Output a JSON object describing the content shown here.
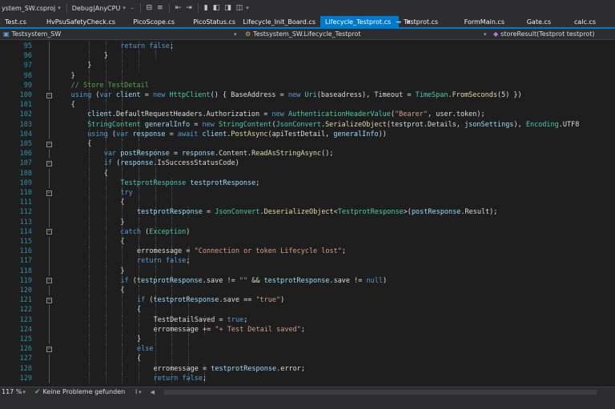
{
  "toolbar": {
    "project_label": "ystem_SW.csproj",
    "config_label": "Debug|AnyCPU"
  },
  "tabs": [
    {
      "label": "Test.cs",
      "active": false
    },
    {
      "label": "HvPsuSafetyCheck.cs",
      "active": false
    },
    {
      "label": "PicoScope.cs",
      "active": false
    },
    {
      "label": "PicoStatus.cs",
      "active": false
    },
    {
      "label": "Lifecycle_Init_Board.cs",
      "active": false
    },
    {
      "label": "Lifecycle_Testprot.cs",
      "active": true
    },
    {
      "label": "Testprot.cs",
      "active": false
    },
    {
      "label": "FormMain.cs",
      "active": false
    },
    {
      "label": "Gate.cs",
      "active": false
    },
    {
      "label": "calc.cs",
      "active": false
    }
  ],
  "navbar": {
    "project": "Testsystem_SW",
    "class": "Testsystem_SW.Lifecycle_Testprot",
    "member": "storeResult(Testprot testprot)"
  },
  "editor": {
    "lines": [
      {
        "num": "95",
        "indent": 8,
        "tokens": [
          [
            "kw",
            "return "
          ],
          [
            "kw",
            "false"
          ],
          [
            "pr",
            ";"
          ]
        ]
      },
      {
        "num": "96",
        "indent": 7,
        "tokens": [
          [
            "pr",
            "}"
          ]
        ]
      },
      {
        "num": "97",
        "indent": 6,
        "tokens": [
          [
            "pr",
            "}"
          ]
        ]
      },
      {
        "num": "98",
        "indent": 5,
        "tokens": [
          [
            "pr",
            "}"
          ]
        ]
      },
      {
        "num": "99",
        "indent": 5,
        "tokens": [
          [
            "cm",
            "// Store TestDetail"
          ]
        ]
      },
      {
        "num": "100",
        "indent": 5,
        "tokens": [
          [
            "kw",
            "using "
          ],
          [
            "pr",
            "("
          ],
          [
            "kw",
            "var "
          ],
          [
            "vr",
            "client"
          ],
          [
            "pr",
            " = "
          ],
          [
            "kw",
            "new "
          ],
          [
            "ty",
            "HttpClient"
          ],
          [
            "pr",
            "() { BaseAddress = "
          ],
          [
            "kw",
            "new "
          ],
          [
            "ty",
            "Uri"
          ],
          [
            "pr",
            "(baseadress), Timeout = "
          ],
          [
            "ty",
            "TimeSpan"
          ],
          [
            "pr",
            "."
          ],
          [
            "mt",
            "FromSeconds"
          ],
          [
            "pr",
            "(5) })"
          ]
        ]
      },
      {
        "num": "101",
        "indent": 5,
        "tokens": [
          [
            "pr",
            "{"
          ]
        ]
      },
      {
        "num": "102",
        "indent": 6,
        "tokens": [
          [
            "vr",
            "client"
          ],
          [
            "pr",
            ".DefaultRequestHeaders.Authorization = "
          ],
          [
            "kw",
            "new "
          ],
          [
            "ty",
            "AuthenticationHeaderValue"
          ],
          [
            "pr",
            "("
          ],
          [
            "st",
            "\"Bearer\""
          ],
          [
            "pr",
            ", user.token);"
          ]
        ]
      },
      {
        "num": "103",
        "indent": 6,
        "tokens": [
          [
            "ty",
            "StringContent "
          ],
          [
            "vr",
            "generalInfo"
          ],
          [
            "pr",
            " = "
          ],
          [
            "kw",
            "new "
          ],
          [
            "ty",
            "StringContent"
          ],
          [
            "pr",
            "("
          ],
          [
            "ty",
            "JsonConvert"
          ],
          [
            "pr",
            "."
          ],
          [
            "mt",
            "SerializeObject"
          ],
          [
            "pr",
            "(testprot.Details, "
          ],
          [
            "vr",
            "jsonSettings"
          ],
          [
            "pr",
            "), "
          ],
          [
            "ty",
            "Encoding"
          ],
          [
            "pr",
            ".UTF8"
          ]
        ]
      },
      {
        "num": "104",
        "indent": 6,
        "tokens": [
          [
            "kw",
            "using "
          ],
          [
            "pr",
            "("
          ],
          [
            "kw",
            "var "
          ],
          [
            "vr",
            "response"
          ],
          [
            "pr",
            " = "
          ],
          [
            "kw",
            "await "
          ],
          [
            "vr",
            "client"
          ],
          [
            "pr",
            "."
          ],
          [
            "mt",
            "PostAsync"
          ],
          [
            "pr",
            "(apiTestDetail, "
          ],
          [
            "vr",
            "generalInfo"
          ],
          [
            "pr",
            "))"
          ]
        ]
      },
      {
        "num": "105",
        "indent": 6,
        "tokens": [
          [
            "pr",
            "{"
          ]
        ]
      },
      {
        "num": "106",
        "indent": 7,
        "tokens": [
          [
            "kw",
            "var "
          ],
          [
            "vr",
            "postResponse"
          ],
          [
            "pr",
            " = "
          ],
          [
            "vr",
            "response"
          ],
          [
            "pr",
            ".Content."
          ],
          [
            "mt",
            "ReadAsStringAsync"
          ],
          [
            "pr",
            "();"
          ]
        ]
      },
      {
        "num": "107",
        "indent": 7,
        "tokens": [
          [
            "kw",
            "if "
          ],
          [
            "pr",
            "("
          ],
          [
            "vr",
            "response"
          ],
          [
            "pr",
            ".IsSuccessStatusCode)"
          ]
        ]
      },
      {
        "num": "108",
        "indent": 7,
        "tokens": [
          [
            "pr",
            "{"
          ]
        ]
      },
      {
        "num": "109",
        "indent": 8,
        "tokens": [
          [
            "ty",
            "TestprotResponse "
          ],
          [
            "vr",
            "testprotResponse"
          ],
          [
            "pr",
            ";"
          ]
        ]
      },
      {
        "num": "110",
        "indent": 8,
        "tokens": [
          [
            "kw",
            "try"
          ]
        ]
      },
      {
        "num": "111",
        "indent": 8,
        "tokens": [
          [
            "pr",
            "{"
          ]
        ]
      },
      {
        "num": "112",
        "indent": 9,
        "tokens": [
          [
            "vr",
            "testprotResponse"
          ],
          [
            "pr",
            " = "
          ],
          [
            "ty",
            "JsonConvert"
          ],
          [
            "pr",
            "."
          ],
          [
            "mt",
            "DeserializeObject"
          ],
          [
            "pr",
            "<"
          ],
          [
            "ty",
            "TestprotResponse"
          ],
          [
            "pr",
            ">("
          ],
          [
            "vr",
            "postResponse"
          ],
          [
            "pr",
            ".Result);"
          ]
        ]
      },
      {
        "num": "113",
        "indent": 8,
        "tokens": [
          [
            "pr",
            "}"
          ]
        ]
      },
      {
        "num": "114",
        "indent": 8,
        "tokens": [
          [
            "kw",
            "catch "
          ],
          [
            "pr",
            "("
          ],
          [
            "ty",
            "Exception"
          ],
          [
            "pr",
            ")"
          ]
        ]
      },
      {
        "num": "115",
        "indent": 8,
        "tokens": [
          [
            "pr",
            "{"
          ]
        ]
      },
      {
        "num": "116",
        "indent": 9,
        "tokens": [
          [
            "pr",
            "erromessage = "
          ],
          [
            "st",
            "\"Connection or token Lifecycle lost\""
          ],
          [
            "pr",
            ";"
          ]
        ]
      },
      {
        "num": "117",
        "indent": 9,
        "tokens": [
          [
            "kw",
            "return "
          ],
          [
            "kw",
            "false"
          ],
          [
            "pr",
            ";"
          ]
        ]
      },
      {
        "num": "118",
        "indent": 8,
        "tokens": [
          [
            "pr",
            "}"
          ]
        ]
      },
      {
        "num": "119",
        "indent": 8,
        "tokens": [
          [
            "kw",
            "if "
          ],
          [
            "pr",
            "("
          ],
          [
            "vr",
            "testprotResponse"
          ],
          [
            "pr",
            ".save != "
          ],
          [
            "st",
            "\"\""
          ],
          [
            "pr",
            " && "
          ],
          [
            "vr",
            "testprotResponse"
          ],
          [
            "pr",
            ".save != "
          ],
          [
            "kw",
            "null"
          ],
          [
            "pr",
            ")"
          ]
        ]
      },
      {
        "num": "120",
        "indent": 8,
        "tokens": [
          [
            "pr",
            "{"
          ]
        ]
      },
      {
        "num": "121",
        "indent": 9,
        "tokens": [
          [
            "kw",
            "if "
          ],
          [
            "pr",
            "("
          ],
          [
            "vr",
            "testprotResponse"
          ],
          [
            "pr",
            ".save == "
          ],
          [
            "st",
            "\"true\""
          ],
          [
            "pr",
            ")"
          ]
        ]
      },
      {
        "num": "122",
        "indent": 9,
        "tokens": [
          [
            "pr",
            "{"
          ]
        ]
      },
      {
        "num": "123",
        "indent": 10,
        "tokens": [
          [
            "pr",
            "TestDetailSaved = "
          ],
          [
            "kw",
            "true"
          ],
          [
            "pr",
            ";"
          ]
        ]
      },
      {
        "num": "124",
        "indent": 10,
        "tokens": [
          [
            "pr",
            "erromessage += "
          ],
          [
            "st",
            "\"+ Test Detail saved\""
          ],
          [
            "pr",
            ";"
          ]
        ]
      },
      {
        "num": "125",
        "indent": 9,
        "tokens": [
          [
            "pr",
            "}"
          ]
        ]
      },
      {
        "num": "126",
        "indent": 9,
        "tokens": [
          [
            "kw",
            "else"
          ]
        ]
      },
      {
        "num": "127",
        "indent": 9,
        "tokens": [
          [
            "pr",
            "{"
          ]
        ]
      },
      {
        "num": "128",
        "indent": 10,
        "tokens": [
          [
            "pr",
            "erromessage = "
          ],
          [
            "vr",
            "testprotResponse"
          ],
          [
            "pr",
            ".error;"
          ]
        ]
      },
      {
        "num": "129",
        "indent": 10,
        "tokens": [
          [
            "kw",
            "return "
          ],
          [
            "kw",
            "false"
          ],
          [
            "pr",
            ";"
          ]
        ]
      }
    ]
  },
  "status": {
    "zoom": "117 %",
    "issues": "Keine Probleme gefunden"
  }
}
